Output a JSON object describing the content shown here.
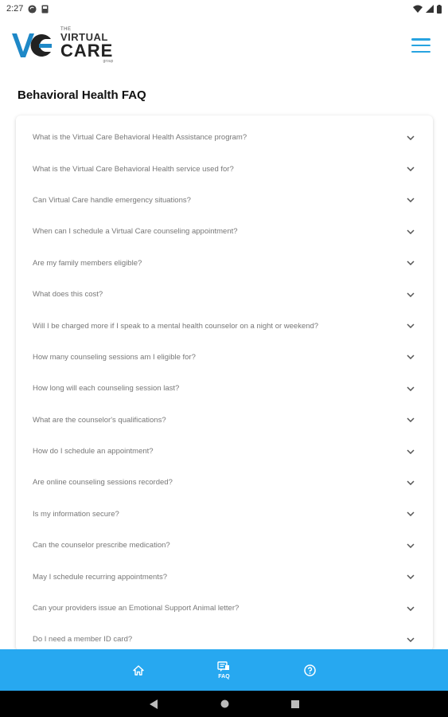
{
  "status": {
    "time": "2:27"
  },
  "logo": {
    "the": "THE",
    "virtual": "VIRTUAL",
    "care": "CARE",
    "group": "group"
  },
  "page": {
    "title": "Behavioral Health FAQ"
  },
  "faq": [
    {
      "question": "What is the Virtual Care Behavioral Health Assistance program?"
    },
    {
      "question": "What is the Virtual Care Behavioral Health service used for?"
    },
    {
      "question": "Can Virtual Care handle emergency situations?"
    },
    {
      "question": "When can I schedule a Virtual Care counseling appointment?"
    },
    {
      "question": "Are my family members eligible?"
    },
    {
      "question": "What does this cost?"
    },
    {
      "question": "Will I be charged more if I speak to a mental health counselor on a night or weekend?"
    },
    {
      "question": "How many counseling sessions am I eligible for?"
    },
    {
      "question": "How long will each counseling session last?"
    },
    {
      "question": "What are the counselor's qualifications?"
    },
    {
      "question": "How do I schedule an appointment?"
    },
    {
      "question": "Are online counseling sessions recorded?"
    },
    {
      "question": "Is my information secure?"
    },
    {
      "question": "Can the counselor prescribe medication?"
    },
    {
      "question": "May I schedule recurring appointments?"
    },
    {
      "question": "Can your providers issue an Emotional Support Animal letter?"
    },
    {
      "question": "Do I need a member ID card?"
    }
  ],
  "nav": {
    "faq_label": "FAQ"
  },
  "colors": {
    "accent": "#27a8f0",
    "menu": "#27a3e0",
    "logo_blue": "#1e88c7"
  }
}
